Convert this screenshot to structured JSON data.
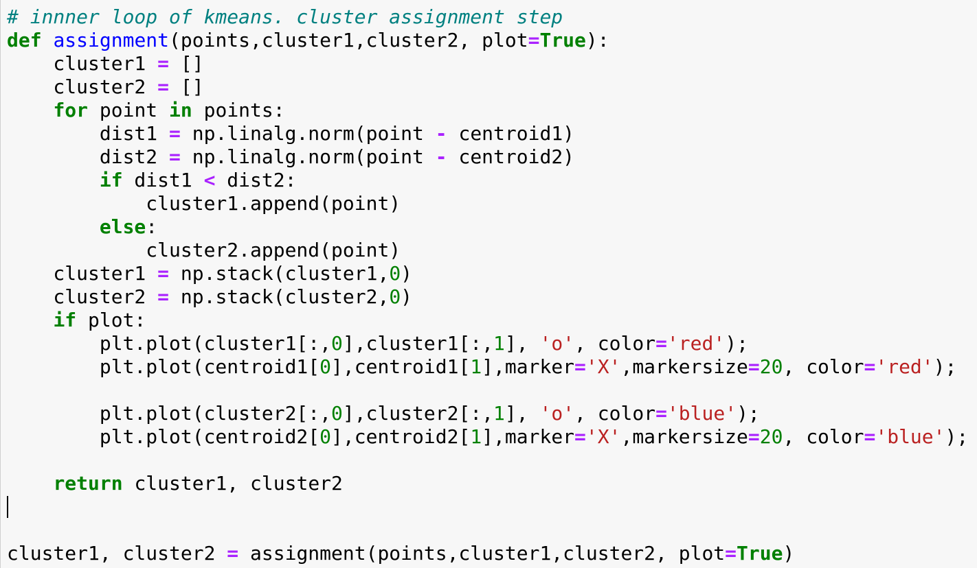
{
  "editor": {
    "lines": [
      [
        {
          "t": "# innner loop of kmeans. cluster assignment step",
          "c": "comment"
        }
      ],
      [
        {
          "t": "def",
          "c": "kw"
        },
        {
          "t": " "
        },
        {
          "t": "assignment",
          "c": "fn"
        },
        {
          "t": "(points,cluster1,cluster2, plot"
        },
        {
          "t": "=",
          "c": "op"
        },
        {
          "t": "True",
          "c": "kw"
        },
        {
          "t": "):"
        }
      ],
      [
        {
          "t": "    cluster1 "
        },
        {
          "t": "=",
          "c": "op"
        },
        {
          "t": " []"
        }
      ],
      [
        {
          "t": "    cluster2 "
        },
        {
          "t": "=",
          "c": "op"
        },
        {
          "t": " []"
        }
      ],
      [
        {
          "t": "    "
        },
        {
          "t": "for",
          "c": "kw"
        },
        {
          "t": " point "
        },
        {
          "t": "in",
          "c": "kw"
        },
        {
          "t": " points:"
        }
      ],
      [
        {
          "t": "        dist1 "
        },
        {
          "t": "=",
          "c": "op"
        },
        {
          "t": " np.linalg.norm(point "
        },
        {
          "t": "-",
          "c": "op"
        },
        {
          "t": " centroid1)"
        }
      ],
      [
        {
          "t": "        dist2 "
        },
        {
          "t": "=",
          "c": "op"
        },
        {
          "t": " np.linalg.norm(point "
        },
        {
          "t": "-",
          "c": "op"
        },
        {
          "t": " centroid2)"
        }
      ],
      [
        {
          "t": "        "
        },
        {
          "t": "if",
          "c": "kw"
        },
        {
          "t": " dist1 "
        },
        {
          "t": "<",
          "c": "op"
        },
        {
          "t": " dist2:"
        }
      ],
      [
        {
          "t": "            cluster1.append(point)"
        }
      ],
      [
        {
          "t": "        "
        },
        {
          "t": "else",
          "c": "kw"
        },
        {
          "t": ":"
        }
      ],
      [
        {
          "t": "            cluster2.append(point)"
        }
      ],
      [
        {
          "t": "    cluster1 "
        },
        {
          "t": "=",
          "c": "op"
        },
        {
          "t": " np.stack(cluster1,"
        },
        {
          "t": "0",
          "c": "num"
        },
        {
          "t": ")"
        }
      ],
      [
        {
          "t": "    cluster2 "
        },
        {
          "t": "=",
          "c": "op"
        },
        {
          "t": " np.stack(cluster2,"
        },
        {
          "t": "0",
          "c": "num"
        },
        {
          "t": ")"
        }
      ],
      [
        {
          "t": "    "
        },
        {
          "t": "if",
          "c": "kw"
        },
        {
          "t": " plot:"
        }
      ],
      [
        {
          "t": "        plt.plot(cluster1[:,"
        },
        {
          "t": "0",
          "c": "num"
        },
        {
          "t": "],cluster1[:,"
        },
        {
          "t": "1",
          "c": "num"
        },
        {
          "t": "], "
        },
        {
          "t": "'o'",
          "c": "str"
        },
        {
          "t": ", color"
        },
        {
          "t": "=",
          "c": "op"
        },
        {
          "t": "'red'",
          "c": "str"
        },
        {
          "t": ");"
        }
      ],
      [
        {
          "t": "        plt.plot(centroid1["
        },
        {
          "t": "0",
          "c": "num"
        },
        {
          "t": "],centroid1["
        },
        {
          "t": "1",
          "c": "num"
        },
        {
          "t": "],marker"
        },
        {
          "t": "=",
          "c": "op"
        },
        {
          "t": "'X'",
          "c": "str"
        },
        {
          "t": ",markersize"
        },
        {
          "t": "=",
          "c": "op"
        },
        {
          "t": "20",
          "c": "num"
        },
        {
          "t": ", color"
        },
        {
          "t": "=",
          "c": "op"
        },
        {
          "t": "'red'",
          "c": "str"
        },
        {
          "t": ");"
        }
      ],
      [],
      [
        {
          "t": "        plt.plot(cluster2[:,"
        },
        {
          "t": "0",
          "c": "num"
        },
        {
          "t": "],cluster2[:,"
        },
        {
          "t": "1",
          "c": "num"
        },
        {
          "t": "], "
        },
        {
          "t": "'o'",
          "c": "str"
        },
        {
          "t": ", color"
        },
        {
          "t": "=",
          "c": "op"
        },
        {
          "t": "'blue'",
          "c": "str"
        },
        {
          "t": ");"
        }
      ],
      [
        {
          "t": "        plt.plot(centroid2["
        },
        {
          "t": "0",
          "c": "num"
        },
        {
          "t": "],centroid2["
        },
        {
          "t": "1",
          "c": "num"
        },
        {
          "t": "],marker"
        },
        {
          "t": "=",
          "c": "op"
        },
        {
          "t": "'X'",
          "c": "str"
        },
        {
          "t": ",markersize"
        },
        {
          "t": "=",
          "c": "op"
        },
        {
          "t": "20",
          "c": "num"
        },
        {
          "t": ", color"
        },
        {
          "t": "=",
          "c": "op"
        },
        {
          "t": "'blue'",
          "c": "str"
        },
        {
          "t": ");"
        }
      ],
      [],
      [
        {
          "t": "    "
        },
        {
          "t": "return",
          "c": "kw"
        },
        {
          "t": " cluster1, cluster2"
        }
      ],
      "CURSOR",
      [],
      [
        {
          "t": "cluster1, cluster2 "
        },
        {
          "t": "=",
          "c": "op"
        },
        {
          "t": " assignment(points,cluster1,cluster2, plot"
        },
        {
          "t": "=",
          "c": "op"
        },
        {
          "t": "True",
          "c": "kw"
        },
        {
          "t": ")"
        }
      ]
    ]
  },
  "colors": {
    "background": "#f7f7f7",
    "comment": "#008080",
    "keyword": "#008000",
    "function": "#0000ff",
    "operator": "#aa22ff",
    "number": "#008000",
    "string": "#ba2121",
    "text": "#000000"
  }
}
